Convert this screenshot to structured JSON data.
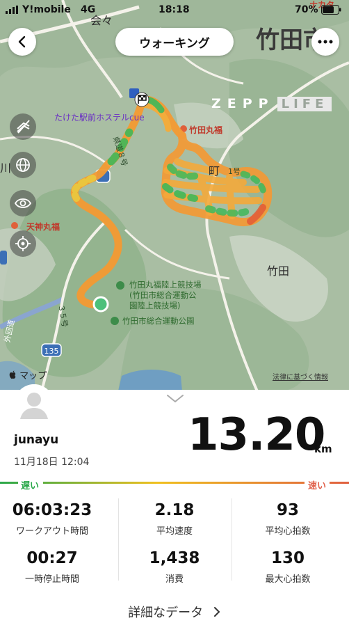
{
  "status_bar": {
    "carrier": "Y!mobile",
    "network": "4G",
    "time": "18:18",
    "battery": "70%"
  },
  "header": {
    "title": "ウォーキング",
    "back_icon": "chevron-left-icon",
    "more_icon": "ellipsis-icon"
  },
  "map": {
    "labels": {
      "city_big": "竹田市",
      "area_top": "会々",
      "hotel": "たけた駅前ホステルcue",
      "route8": "県道８号",
      "restaurant": "竹田丸福",
      "restaurant2": "天神丸福",
      "town": "竹田",
      "kawa": "川",
      "machi": "町",
      "stadium1": "竹田丸福陸上競技場",
      "stadium2": "(竹田市総合運動公",
      "stadium3": "園陸上競技場)",
      "park": "竹田市総合運動公園",
      "road135": "135",
      "route35": "３５号",
      "road_bottom": "外回道",
      "nakata": "ナカタ",
      "hyou": "1号"
    },
    "zepp_logo": {
      "left": "ZEPP",
      "right": "LIFE"
    },
    "brand": "マップ",
    "legal": "法律に基づく情報",
    "side_icons": [
      "layers-off-icon",
      "globe-icon",
      "eye-icon",
      "locate-icon"
    ]
  },
  "summary": {
    "username": "junayu",
    "datetime": "11月18日 12:04",
    "distance_value": "13.20",
    "distance_unit": "km",
    "slow_label": "遅い",
    "fast_label": "速い",
    "colors": {
      "slow": "#2aa84a",
      "mid": "#f0c020",
      "fast": "#e06040"
    }
  },
  "stats": [
    {
      "value": "06:03:23",
      "label": "ワークアウト時間"
    },
    {
      "value": "2.18",
      "label": "平均速度"
    },
    {
      "value": "93",
      "label": "平均心拍数"
    },
    {
      "value": "00:27",
      "label": "一時停止時間"
    },
    {
      "value": "1,438",
      "label": "消費"
    },
    {
      "value": "130",
      "label": "最大心拍数"
    }
  ],
  "details_link": "詳細なデータ"
}
